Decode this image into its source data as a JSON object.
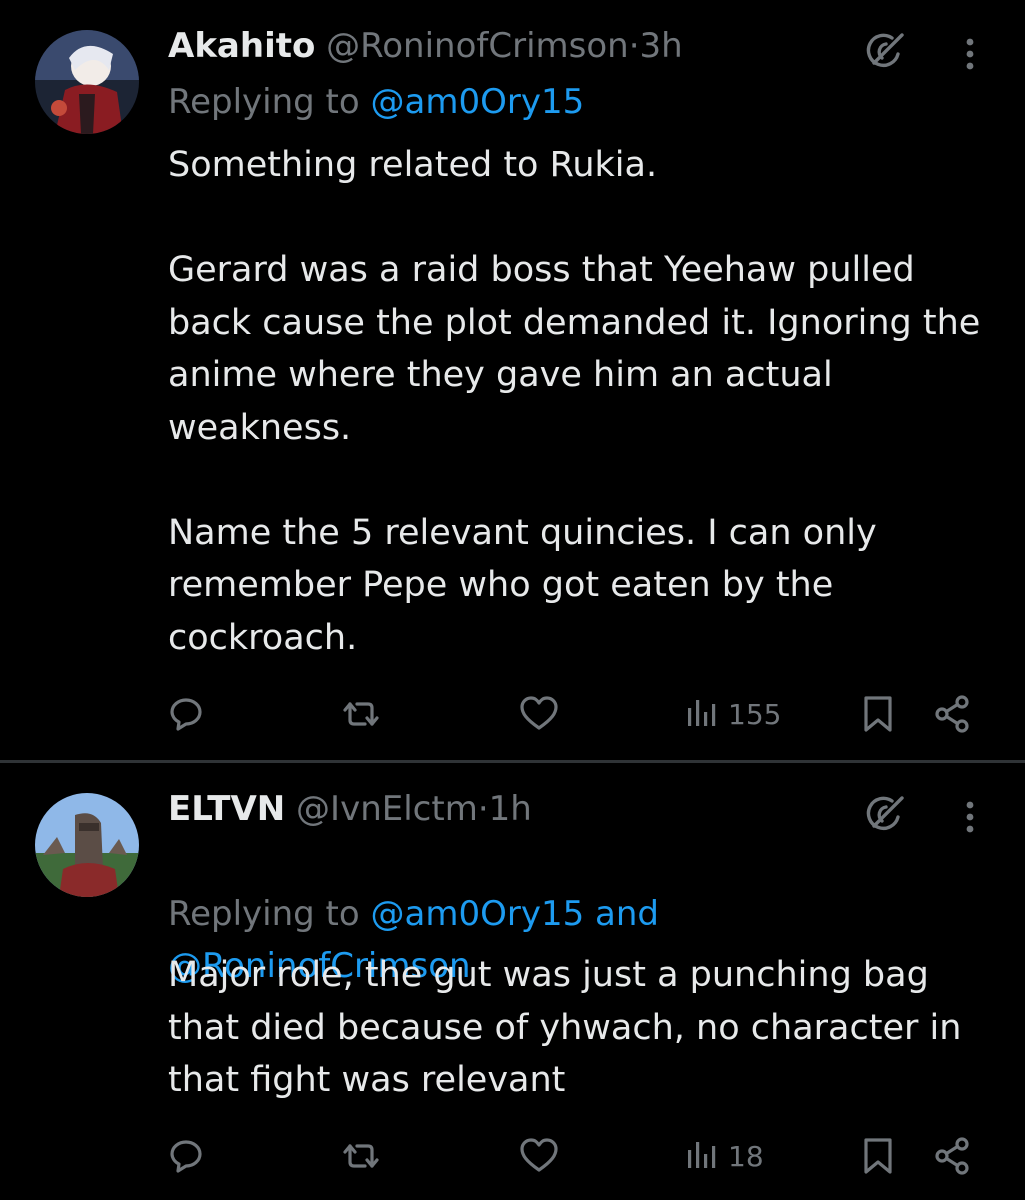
{
  "tweets": [
    {
      "name": "Akahito",
      "handle": "@RoninofCrimson",
      "dot": "·",
      "time": "3h",
      "replying_prefix": "Replying to ",
      "replying_to": "@am0Ory15",
      "text": "Something related to Rukia.\n\nGerard was a raid boss that Yeehaw pulled back cause the plot demanded it. Ignoring the anime where they gave him an actual weakness.\n\nName the 5 relevant quincies. I can only remember Pepe who got eaten by the cockroach.",
      "views": "155",
      "icons": [
        "reply-icon",
        "retweet-icon",
        "like-icon",
        "views-icon",
        "bookmark-icon",
        "share-icon"
      ]
    },
    {
      "name": "ELTVN",
      "handle": "@IvnElctm",
      "dot": "·",
      "time": "1h",
      "replying_prefix": "Replying to ",
      "replying_to": "@am0Ory15 and\n@RoninofCrimson",
      "text": "Major role, the gut was just a punching bag that died because of yhwach, no character in that fight was relevant",
      "views": "18",
      "icons": [
        "reply-icon",
        "retweet-icon",
        "like-icon",
        "views-icon",
        "bookmark-icon",
        "share-icon"
      ]
    }
  ],
  "colors": {
    "background": "#000000",
    "text": "#e7e9ea",
    "muted": "#71767b",
    "link": "#1d9bf0",
    "divider": "#2f3336"
  }
}
